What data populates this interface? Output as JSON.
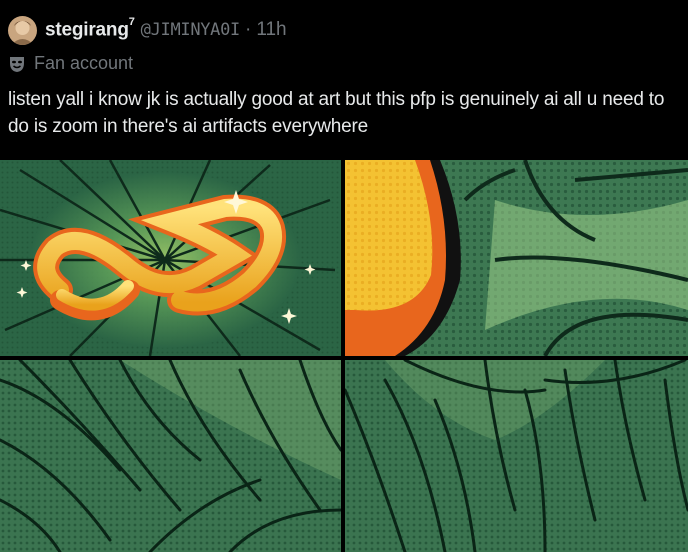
{
  "post": {
    "display_name": "stegirang",
    "name_suffix": "7",
    "handle": "@JIMINYA0I",
    "separator": "·",
    "time": "11h",
    "fan_label": "Fan account",
    "text": "listen yall i know jk is actually good at art but this pfp is genuinely ai all u need to do is zoom in there's ai artifacts everywhere"
  },
  "media": {
    "images": [
      {
        "description_name": "full-logo"
      },
      {
        "description_name": "zoom-top-right"
      },
      {
        "description_name": "zoom-bottom-left"
      },
      {
        "description_name": "zoom-bottom-right"
      }
    ]
  },
  "colors": {
    "background": "#000000",
    "text": "#e7e9ea",
    "muted": "#71767b",
    "comic_green": "#2b6545",
    "logo_gold": "#f2b82c",
    "logo_orange": "#e8661d"
  },
  "icons": [
    "avatar",
    "mask-icon"
  ]
}
